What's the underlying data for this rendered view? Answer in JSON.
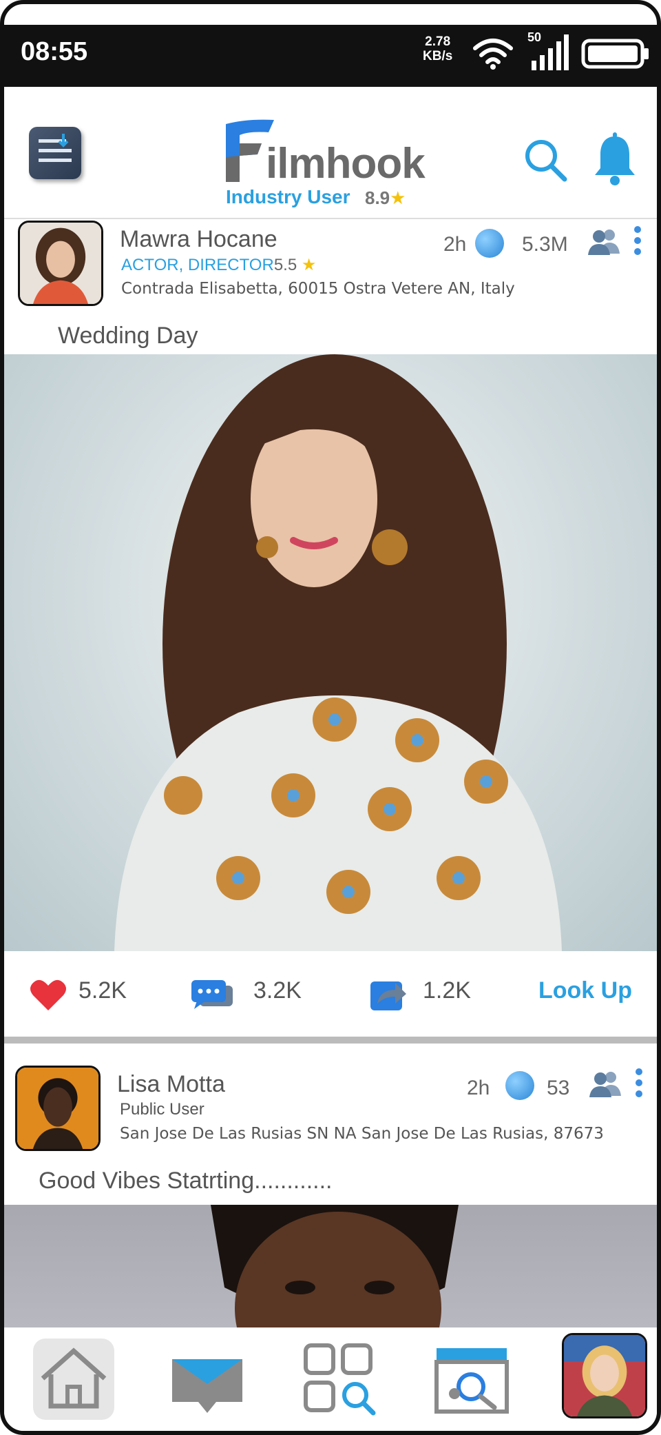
{
  "status_bar": {
    "time": "08:55",
    "speed_value": "2.78",
    "speed_unit": "KB/s",
    "signal_label": "50"
  },
  "header": {
    "logo_text": "ilmhook",
    "user_type": "Industry User",
    "user_rating": "8.9"
  },
  "posts": [
    {
      "name": "Mawra Hocane",
      "role": "ACTOR, DIRECTOR",
      "role_score": "5.5",
      "address": "Contrada Elisabetta, 60015 Ostra Vetere AN, Italy",
      "time": "2h",
      "views": "5.3M",
      "caption": "Wedding Day",
      "likes": "5.2K",
      "comments": "3.2K",
      "shares": "1.2K",
      "lookup_label": "Look Up"
    },
    {
      "name": "Lisa Motta",
      "role": "Public  User",
      "address": "San Jose De Las Rusias SN NA San Jose De Las Rusias, 87673",
      "time": "2h",
      "views": "53",
      "caption": "Good Vibes Statrting............"
    }
  ],
  "colors": {
    "accent": "#2aa0e0",
    "like": "#e8323c",
    "star": "#f4c20d"
  },
  "nav": [
    "home-icon",
    "messages-icon",
    "explore-icon",
    "film-search-icon",
    "profile-avatar"
  ]
}
